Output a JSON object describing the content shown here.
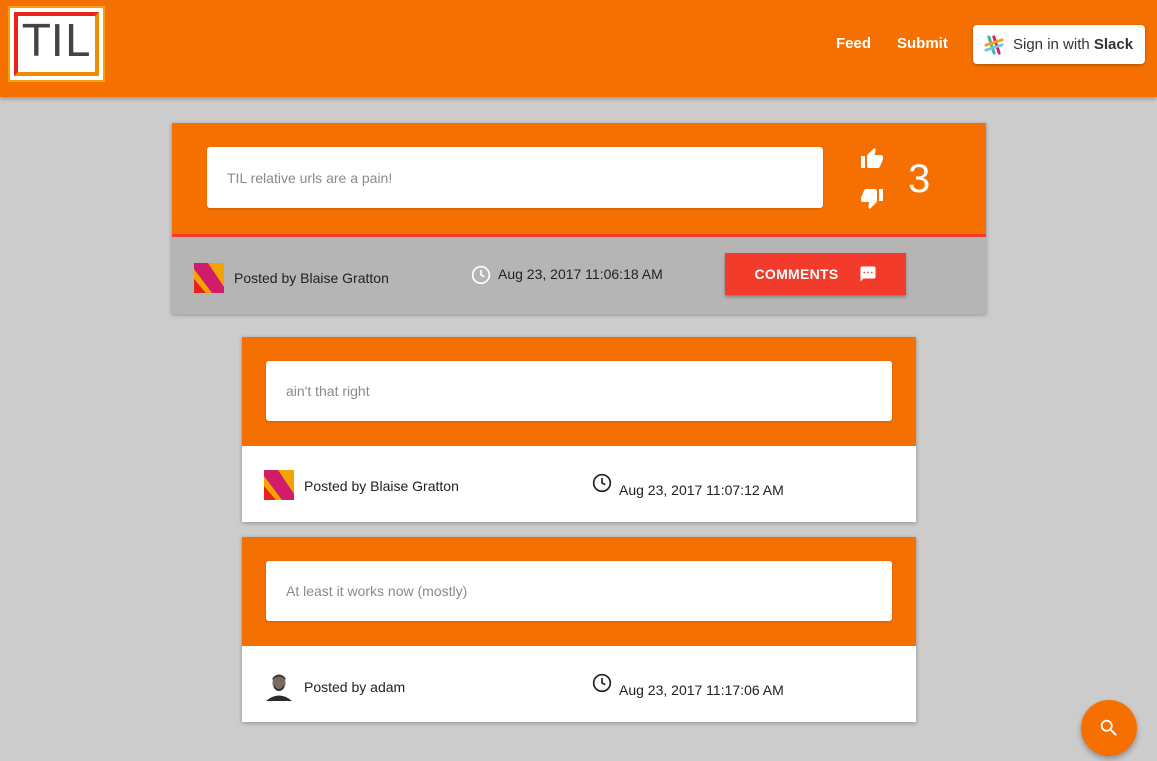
{
  "header": {
    "logo_text": "TIL",
    "nav": [
      {
        "label": "Feed"
      },
      {
        "label": "Submit"
      }
    ],
    "signin": {
      "prefix": "Sign in with ",
      "brand": "Slack"
    }
  },
  "post": {
    "text": "TIL relative urls are a pain!",
    "score": "3",
    "author": "Posted by Blaise Gratton",
    "timestamp": "Aug 23, 2017 11:06:18 AM",
    "comments_label": "COMMENTS"
  },
  "comments": [
    {
      "text": "ain't that right",
      "author": "Posted by Blaise Gratton",
      "timestamp": "Aug 23, 2017 11:07:12 AM"
    },
    {
      "text": "At least it works now (mostly)",
      "author": "Posted by adam",
      "timestamp": "Aug 23, 2017 11:17:06 AM"
    }
  ],
  "colors": {
    "brand_orange": "#f57000",
    "comments_red": "#f23b2b",
    "background": "#cccccc"
  },
  "icons": [
    "slack-icon",
    "thumb-up-icon",
    "thumb-down-icon",
    "clock-icon",
    "comment-icon",
    "search-icon"
  ]
}
